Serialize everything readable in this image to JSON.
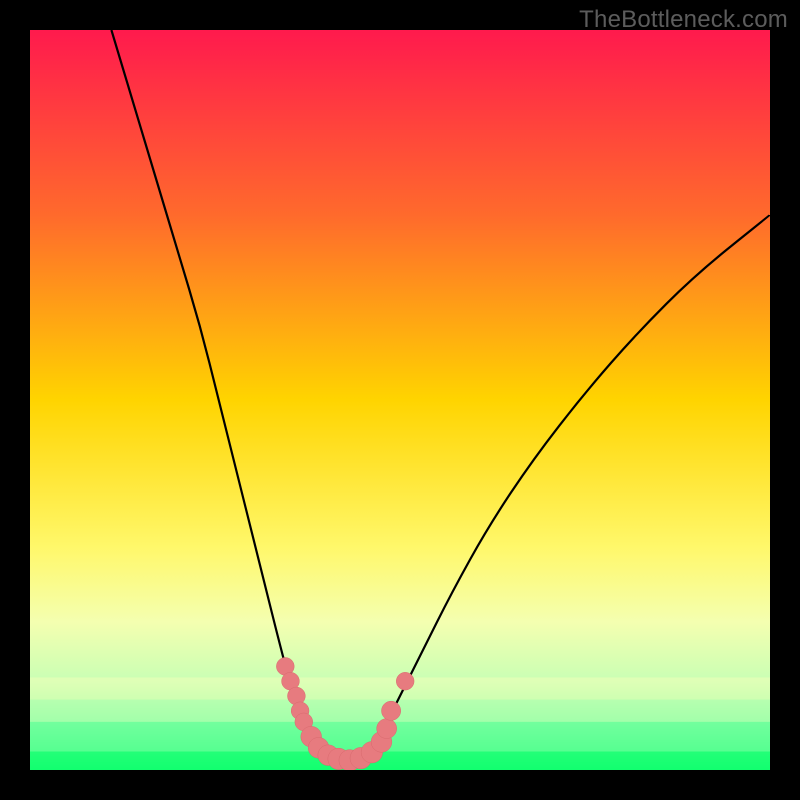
{
  "watermark": "TheBottleneck.com",
  "colors": {
    "frame": "#000000",
    "curve": "#000000",
    "marker_fill": "#e77b7f",
    "marker_stroke": "#d96a6e",
    "bottom_band_green": "#12ff70",
    "bottom_band_pale": "#e8ffda"
  },
  "chart_data": {
    "type": "line",
    "title": "",
    "xlabel": "",
    "ylabel": "",
    "xlim": [
      0,
      100
    ],
    "ylim": [
      0,
      100
    ],
    "gradient_stops": [
      {
        "offset": 0.0,
        "color": "#ff1a4d"
      },
      {
        "offset": 0.25,
        "color": "#ff6a2c"
      },
      {
        "offset": 0.5,
        "color": "#ffd400"
      },
      {
        "offset": 0.7,
        "color": "#fff86b"
      },
      {
        "offset": 0.8,
        "color": "#f4ffb0"
      },
      {
        "offset": 0.88,
        "color": "#c9ffb4"
      },
      {
        "offset": 0.94,
        "color": "#6fff9c"
      },
      {
        "offset": 1.0,
        "color": "#12ff70"
      }
    ],
    "series": [
      {
        "name": "left-curve",
        "points": [
          {
            "x": 11.0,
            "y": 100.0
          },
          {
            "x": 14.0,
            "y": 90.0
          },
          {
            "x": 17.0,
            "y": 80.0
          },
          {
            "x": 20.0,
            "y": 70.0
          },
          {
            "x": 23.0,
            "y": 60.0
          },
          {
            "x": 25.5,
            "y": 50.0
          },
          {
            "x": 28.0,
            "y": 40.0
          },
          {
            "x": 30.0,
            "y": 32.0
          },
          {
            "x": 32.0,
            "y": 24.0
          },
          {
            "x": 33.5,
            "y": 18.0
          },
          {
            "x": 34.8,
            "y": 13.0
          },
          {
            "x": 36.0,
            "y": 9.0
          },
          {
            "x": 37.0,
            "y": 6.0
          },
          {
            "x": 38.0,
            "y": 4.0
          },
          {
            "x": 39.0,
            "y": 2.6
          },
          {
            "x": 40.0,
            "y": 1.8
          },
          {
            "x": 41.0,
            "y": 1.4
          },
          {
            "x": 42.0,
            "y": 1.2
          },
          {
            "x": 43.0,
            "y": 1.2
          },
          {
            "x": 44.0,
            "y": 1.4
          }
        ]
      },
      {
        "name": "right-curve",
        "points": [
          {
            "x": 44.0,
            "y": 1.4
          },
          {
            "x": 45.0,
            "y": 1.8
          },
          {
            "x": 46.0,
            "y": 2.6
          },
          {
            "x": 47.0,
            "y": 4.0
          },
          {
            "x": 48.0,
            "y": 6.0
          },
          {
            "x": 50.0,
            "y": 10.0
          },
          {
            "x": 53.0,
            "y": 16.0
          },
          {
            "x": 57.0,
            "y": 24.0
          },
          {
            "x": 62.0,
            "y": 33.0
          },
          {
            "x": 68.0,
            "y": 42.0
          },
          {
            "x": 75.0,
            "y": 51.0
          },
          {
            "x": 82.0,
            "y": 59.0
          },
          {
            "x": 90.0,
            "y": 67.0
          },
          {
            "x": 100.0,
            "y": 75.0
          }
        ]
      }
    ],
    "markers": [
      {
        "x": 34.5,
        "y": 14.0,
        "r": 1.2
      },
      {
        "x": 35.2,
        "y": 12.0,
        "r": 1.2
      },
      {
        "x": 36.0,
        "y": 10.0,
        "r": 1.2
      },
      {
        "x": 36.5,
        "y": 8.0,
        "r": 1.2
      },
      {
        "x": 37.0,
        "y": 6.5,
        "r": 1.2
      },
      {
        "x": 38.0,
        "y": 4.5,
        "r": 1.4
      },
      {
        "x": 39.0,
        "y": 3.0,
        "r": 1.4
      },
      {
        "x": 40.3,
        "y": 2.0,
        "r": 1.4
      },
      {
        "x": 41.7,
        "y": 1.5,
        "r": 1.45
      },
      {
        "x": 43.2,
        "y": 1.3,
        "r": 1.45
      },
      {
        "x": 44.7,
        "y": 1.6,
        "r": 1.45
      },
      {
        "x": 46.2,
        "y": 2.4,
        "r": 1.45
      },
      {
        "x": 47.5,
        "y": 3.8,
        "r": 1.4
      },
      {
        "x": 48.2,
        "y": 5.6,
        "r": 1.35
      },
      {
        "x": 48.8,
        "y": 8.0,
        "r": 1.3
      },
      {
        "x": 50.7,
        "y": 12.0,
        "r": 1.2
      }
    ]
  }
}
